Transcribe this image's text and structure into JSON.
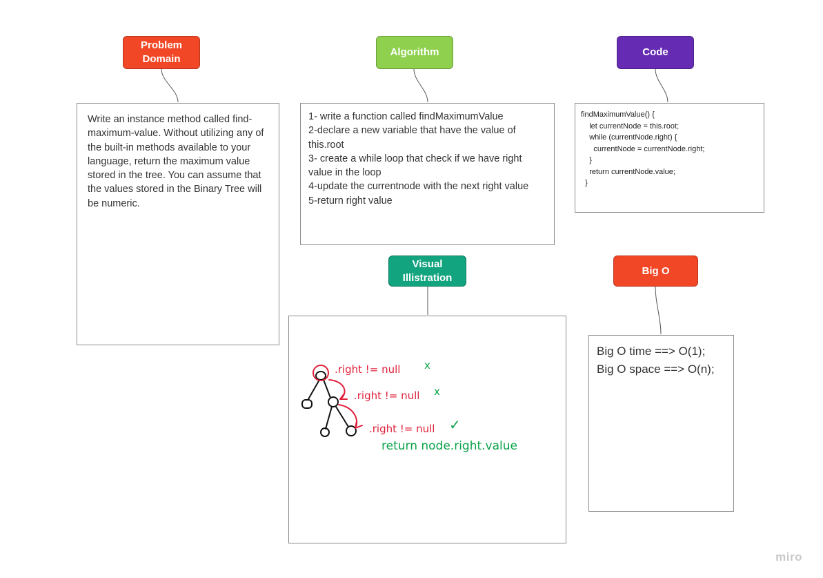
{
  "labels": {
    "problem_domain": "Problem\nDomain",
    "algorithm": "Algorithm",
    "code": "Code",
    "visual": "Visual\nIllistration",
    "big_o": "Big O"
  },
  "colors": {
    "problem_domain": "#f24726",
    "algorithm": "#8fd14f",
    "code": "#652cb3",
    "visual": "#12a37f",
    "big_o": "#f24726",
    "ink_red": "#e0203a",
    "ink_green": "#0ca34a",
    "ink_black": "#111111"
  },
  "problem_text": "Write an instance method called find-maximum-value. Without utilizing any of the built-in methods available to your language, return the maximum value stored in the tree. You can assume that the values stored in the Binary Tree will be numeric.",
  "algorithm_lines": [
    "1- write a function called findMaximumValue",
    "2-declare a new variable that have the value of this.root",
    "3- create a while loop that check if we have  right value in the loop",
    "4-update the currentnode with the next right value",
    "5-return right value"
  ],
  "code_lines": [
    "findMaximumValue() {",
    "    let currentNode = this.root;",
    "    while (currentNode.right) {",
    "      currentNode = currentNode.right;",
    "    }",
    "    return currentNode.value;",
    "  }"
  ],
  "big_o_lines": [
    "Big O time ==> O(1);",
    "Big O space ==> O(n);"
  ],
  "sketch": {
    "annotation_1": ".right != null",
    "annotation_2": ".right != null",
    "annotation_3": ".right != null",
    "mark_1": "x",
    "mark_2": "x",
    "mark_3": "✓",
    "result": "return node.right.value"
  },
  "watermark": "miro"
}
